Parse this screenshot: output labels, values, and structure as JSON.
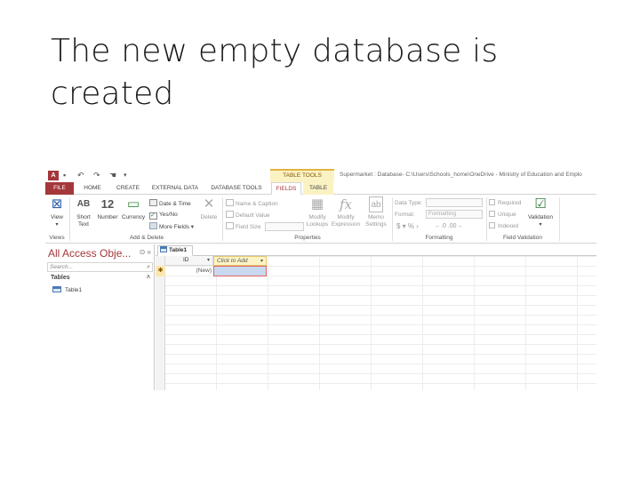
{
  "slide": {
    "title": "The new empty database is created"
  },
  "app": {
    "logo": "A",
    "table_tools_label": "TABLE TOOLS",
    "window_title": "Supermarket : Database- C:\\Users\\Schools_home\\OneDrive - Ministry of Education and Emplo",
    "tabs": [
      "FILE",
      "HOME",
      "CREATE",
      "EXTERNAL DATA",
      "DATABASE TOOLS",
      "FIELDS",
      "TABLE"
    ],
    "active_tab": "FIELDS",
    "accent_color": "#a4373a"
  },
  "ribbon": {
    "views": {
      "view_label": "View",
      "group_label": "Views"
    },
    "add_delete": {
      "short_text_icon": "AB",
      "short_text_label": "Short Text",
      "number_icon": "12",
      "number_label": "Number",
      "currency_label": "Currency",
      "date_time": "Date & Time",
      "yes_no": "Yes/No",
      "more_fields": "More Fields",
      "delete": "Delete",
      "group_label": "Add & Delete"
    },
    "properties": {
      "name_caption": "Name & Caption",
      "default_value": "Default Value",
      "field_size": "Field Size",
      "modify_lookups": "Modify Lookups",
      "modify_expression": "Modify Expression",
      "memo_settings": "Memo Settings",
      "group_label": "Properties"
    },
    "formatting": {
      "data_type_label": "Data Type:",
      "format_label": "Format:",
      "format_value": "Formatting",
      "group_label": "Formatting"
    },
    "field_validation": {
      "required": "Required",
      "unique": "Unique",
      "indexed": "Indexed",
      "validation": "Validation",
      "group_label": "Field Validation"
    }
  },
  "nav": {
    "header": "All Access Obje...",
    "search_placeholder": "Search...",
    "group": "Tables",
    "items": [
      {
        "label": "Table1"
      }
    ]
  },
  "datasheet": {
    "tab_label": "Table1",
    "columns": [
      "ID",
      "Click to Add"
    ],
    "new_row_label": "(New)"
  }
}
